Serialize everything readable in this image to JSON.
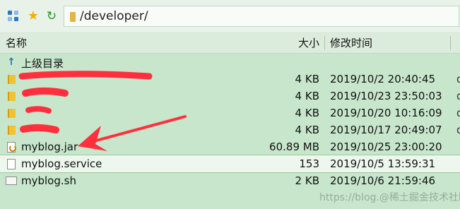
{
  "toolbar": {
    "path": "/developer/"
  },
  "header": {
    "name": "名称",
    "size": "大小",
    "modified": "修改时间"
  },
  "rows": [
    {
      "name": "上级目录",
      "size": "",
      "date": "",
      "extra": "",
      "icon": "up-arrow-icon",
      "redacted": false
    },
    {
      "name": "",
      "size": "4 KB",
      "date": "2019/10/2 20:40:45",
      "extra": "d",
      "icon": "folder-icon",
      "redacted": true
    },
    {
      "name": "",
      "size": "4 KB",
      "date": "2019/10/23 23:50:03",
      "extra": "d",
      "icon": "folder-icon",
      "redacted": true
    },
    {
      "name": "",
      "size": "4 KB",
      "date": "2019/10/20 10:16:09",
      "extra": "d",
      "icon": "folder-icon",
      "redacted": true
    },
    {
      "name": "",
      "size": "4 KB",
      "date": "2019/10/17 20:49:07",
      "extra": "d",
      "icon": "folder-icon",
      "redacted": true
    },
    {
      "name": "myblog.jar",
      "size": "60.89 MB",
      "date": "2019/10/25 23:00:20",
      "extra": "",
      "icon": "jar-file-icon",
      "redacted": false
    },
    {
      "name": "myblog.service",
      "size": "153",
      "date": "2019/10/5 13:59:31",
      "extra": "",
      "icon": "file-icon",
      "redacted": false
    },
    {
      "name": "myblog.sh",
      "size": "2 KB",
      "date": "2019/10/6 21:59:46",
      "extra": "",
      "icon": "script-file-icon",
      "redacted": false
    }
  ],
  "watermark": "https://blog.@稀土掘金技术社区",
  "colors": {
    "background": "#c7e6cc",
    "annotation": "#ff2f3d"
  }
}
